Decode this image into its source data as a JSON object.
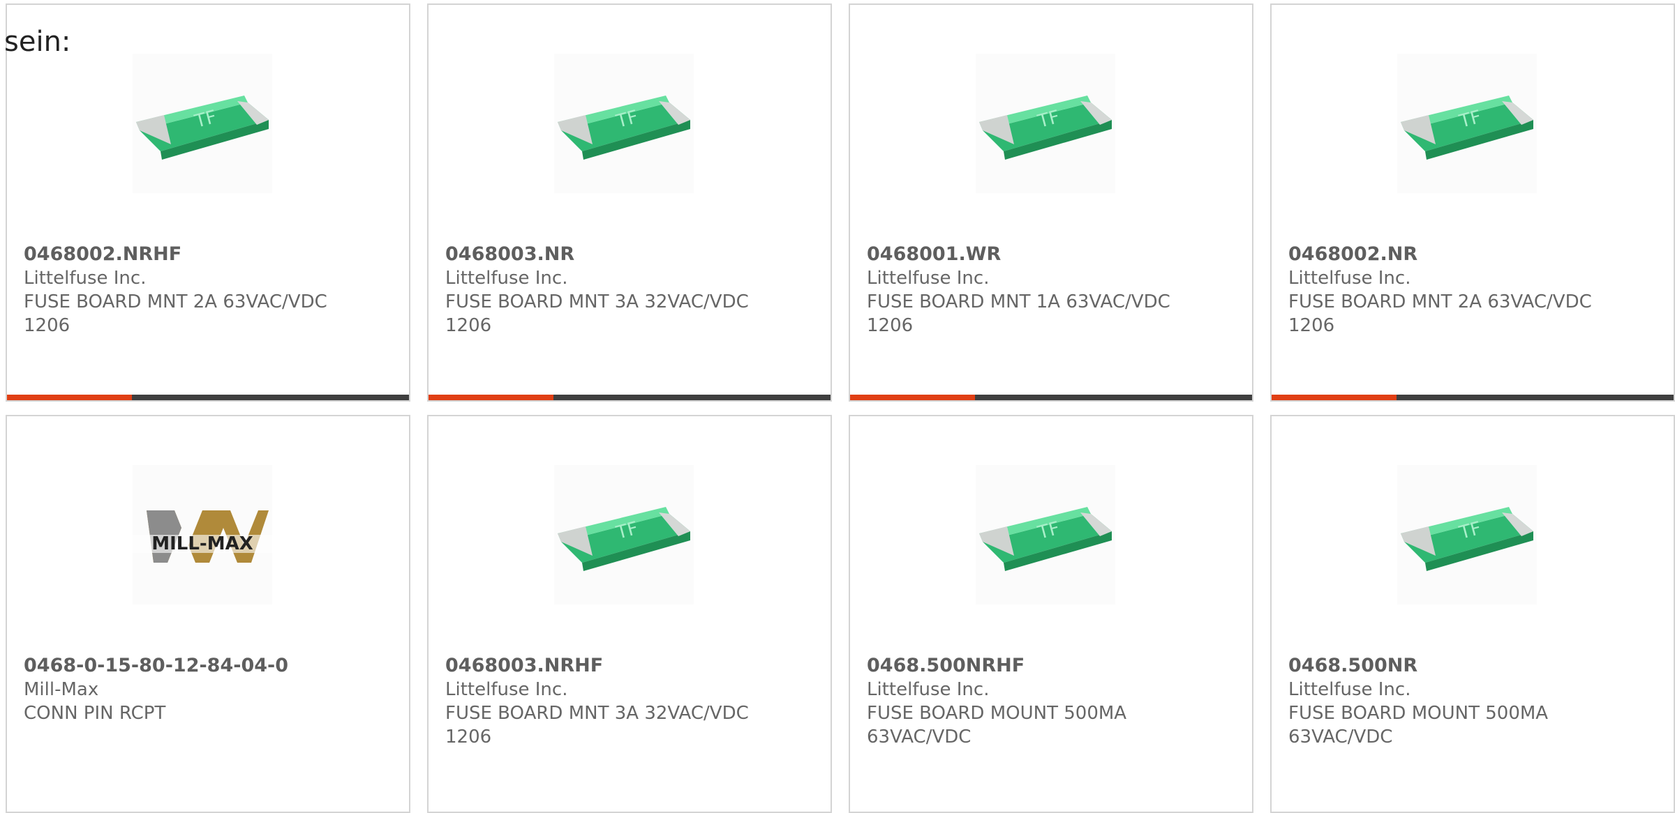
{
  "intro_text": "sein:",
  "colors": {
    "accent": "#e03f14",
    "bar_track": "#3f3f3f",
    "card_border": "#d4d4d4",
    "text": "#666666"
  },
  "products": [
    {
      "part_number": "0468002.NRHF",
      "manufacturer": "Littelfuse Inc.",
      "description": "FUSE BOARD MNT 2A 63VAC/VDC 1206",
      "image": "smd-fuse-icon",
      "progress": 0.31
    },
    {
      "part_number": "0468003.NR",
      "manufacturer": "Littelfuse Inc.",
      "description": "FUSE BOARD MNT 3A 32VAC/VDC 1206",
      "image": "smd-fuse-icon",
      "progress": 0.31
    },
    {
      "part_number": "0468001.WR",
      "manufacturer": "Littelfuse Inc.",
      "description": "FUSE BOARD MNT 1A 63VAC/VDC 1206",
      "image": "smd-fuse-icon",
      "progress": 0.31
    },
    {
      "part_number": "0468002.NR",
      "manufacturer": "Littelfuse Inc.",
      "description": "FUSE BOARD MNT 2A 63VAC/VDC 1206",
      "image": "smd-fuse-icon",
      "progress": 0.31
    },
    {
      "part_number": "0468-0-15-80-12-84-04-0",
      "manufacturer": "Mill-Max",
      "description": "CONN PIN RCPT",
      "image": "mill-max-logo",
      "logo_text": "MILL-MAX"
    },
    {
      "part_number": "0468003.NRHF",
      "manufacturer": "Littelfuse Inc.",
      "description": "FUSE BOARD MNT 3A 32VAC/VDC 1206",
      "image": "smd-fuse-icon"
    },
    {
      "part_number": "0468.500NRHF",
      "manufacturer": "Littelfuse Inc.",
      "description": "FUSE BOARD MOUNT 500MA 63VAC/VDC",
      "image": "smd-fuse-icon"
    },
    {
      "part_number": "0468.500NR",
      "manufacturer": "Littelfuse Inc.",
      "description": "FUSE BOARD MOUNT 500MA 63VAC/VDC",
      "image": "smd-fuse-icon"
    }
  ]
}
